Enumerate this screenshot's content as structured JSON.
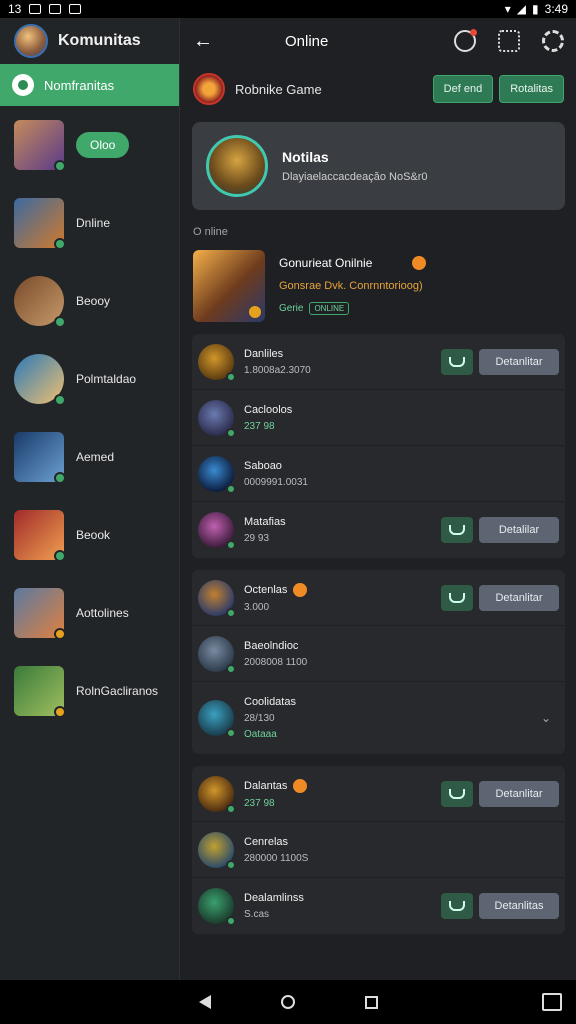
{
  "statusbar": {
    "time": "13",
    "right_time": "3:49"
  },
  "sidebar": {
    "title": "Komunitas",
    "active_label": "Nomfranitas",
    "pill_label": "Oloo",
    "items": [
      {
        "label": "",
        "colors": [
          "#c58b5a",
          "#5a3a8a"
        ]
      },
      {
        "label": "Dnline",
        "colors": [
          "#3b6aa0",
          "#d07a2c"
        ]
      },
      {
        "label": "Beooy",
        "colors": [
          "#7a4a2a",
          "#c59a6a"
        ]
      },
      {
        "label": "Polmtaldao",
        "colors": [
          "#2a79b8",
          "#f0c070"
        ]
      },
      {
        "label": "Aemed",
        "colors": [
          "#1a3a6a",
          "#6aa0d0"
        ]
      },
      {
        "label": "Beook",
        "colors": [
          "#a02a2a",
          "#f0a050"
        ]
      },
      {
        "label": "Aottolines",
        "colors": [
          "#5a7aa0",
          "#e08040"
        ]
      },
      {
        "label": "RolnGacliranos",
        "colors": [
          "#3a7a3a",
          "#a0c060"
        ]
      }
    ]
  },
  "topbar": {
    "title": "Online"
  },
  "game": {
    "name": "Robnike Game",
    "btn1": "Def end",
    "btn2": "Rotalitas"
  },
  "profile": {
    "name": "Notilas",
    "subtitle": "Dlayiaelaccacdeaçăo NoS&r0"
  },
  "section": {
    "label": "O nline"
  },
  "feature": {
    "title": "Gonurieat Onilnie",
    "subtitle": "Gonsrae Dvk. Conrnntorioog)",
    "tag": "Gerie",
    "chip": "ONLINE"
  },
  "groups": [
    {
      "rows": [
        {
          "name": "Danliles",
          "sub": "1.8008a2.3070",
          "sub_green": false,
          "has_dot": false,
          "actions": true,
          "detail": "Detanlitar",
          "colors": [
            "#d0962a",
            "#5a3a10"
          ]
        },
        {
          "name": "Cacloolos",
          "sub": "237 98",
          "sub_green": true,
          "has_dot": false,
          "actions": false,
          "detail": "",
          "colors": [
            "#6a7ab0",
            "#2a2a4a"
          ]
        },
        {
          "name": "Saboao",
          "sub": "0009991.0031",
          "sub_green": false,
          "has_dot": false,
          "actions": false,
          "detail": "",
          "colors": [
            "#3a8ad0",
            "#0a1a3a"
          ]
        },
        {
          "name": "Matafias",
          "sub": "29 93",
          "sub_green": false,
          "has_dot": false,
          "actions": true,
          "detail": "Detalilar",
          "colors": [
            "#c060b0",
            "#3a1a3a"
          ]
        }
      ]
    },
    {
      "rows": [
        {
          "name": "Octenlas",
          "sub": "3.000",
          "sub_green": false,
          "has_dot": true,
          "actions": true,
          "detail": "Detanlitar",
          "colors": [
            "#c08030",
            "#2a3a6a"
          ]
        },
        {
          "name": "Baeolndioc",
          "sub": "2008008 1100",
          "sub_green": false,
          "has_dot": false,
          "actions": false,
          "detail": "",
          "colors": [
            "#7a8aa0",
            "#2a3a4a"
          ]
        },
        {
          "name": "Coolidatas",
          "sub": "28/130",
          "sub_green": false,
          "has_dot": false,
          "actions": false,
          "detail": "",
          "tag": "Oataaa",
          "colors": [
            "#3aa0c0",
            "#1a3a4a"
          ]
        }
      ]
    },
    {
      "rows": [
        {
          "name": "Dalantas",
          "sub": "237 98",
          "sub_green": true,
          "has_dot": true,
          "actions": true,
          "detail": "Detanlitar",
          "colors": [
            "#d0962a",
            "#4a2a10"
          ]
        },
        {
          "name": "Cenrelas",
          "sub": "280000 1100S",
          "sub_green": false,
          "has_dot": false,
          "actions": false,
          "detail": "",
          "colors": [
            "#c0a030",
            "#2a4a6a"
          ]
        },
        {
          "name": "Dealamlinss",
          "sub": "S.cas",
          "sub_green": false,
          "has_dot": false,
          "actions": true,
          "detail": "Detanlitas",
          "colors": [
            "#3aa070",
            "#1a3a2a"
          ]
        }
      ]
    }
  ]
}
